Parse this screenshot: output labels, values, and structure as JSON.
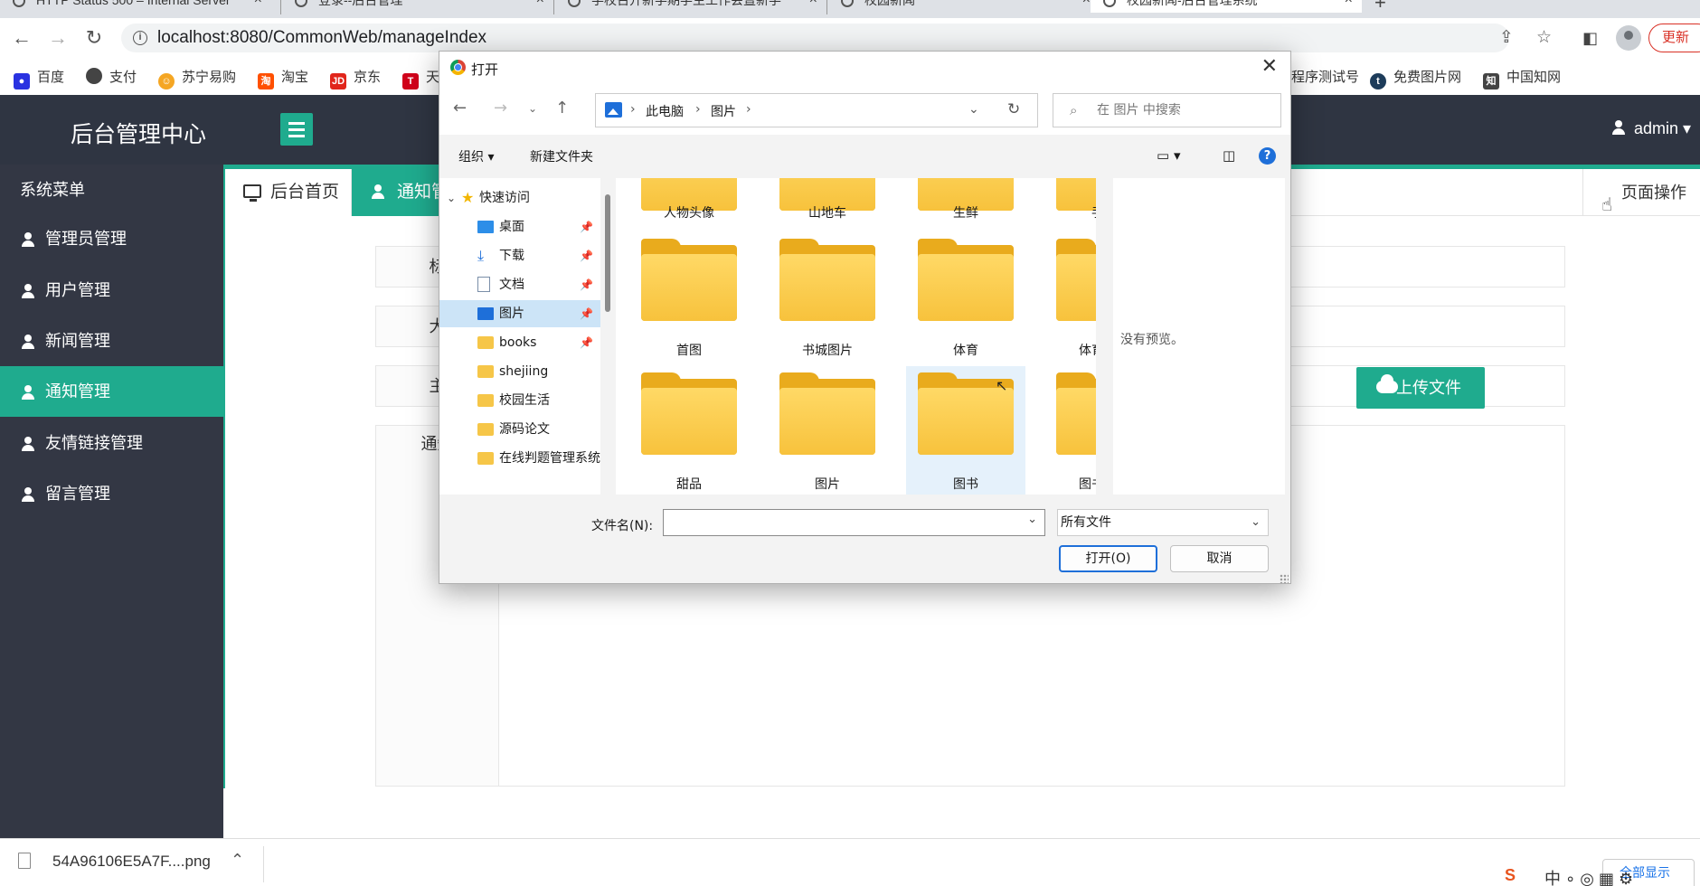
{
  "browser": {
    "tabs": [
      {
        "title": "HTTP Status 500 – Internal Server",
        "active": false
      },
      {
        "title": "登录--后台管理",
        "active": false
      },
      {
        "title": "学校召开新学期学生工作会暨新学",
        "active": false
      },
      {
        "title": "校园新闻",
        "active": false
      },
      {
        "title": "校园新闻-后台管理系统",
        "active": true
      }
    ],
    "url": "localhost:8080/CommonWeb/manageIndex",
    "update_label": "更新",
    "bookmarks_left": [
      "百度",
      "支付",
      "苏宁易购",
      "淘宝",
      "京东",
      "天"
    ],
    "bookmarks_right": [
      "程序测试号",
      "免费图片网",
      "中国知网"
    ]
  },
  "app": {
    "brand": "后台管理中心",
    "user": "admin",
    "sidebar": {
      "title": "系统菜单",
      "items": [
        {
          "label": "管理员管理",
          "active": false
        },
        {
          "label": "用户管理",
          "active": false
        },
        {
          "label": "新闻管理",
          "active": false
        },
        {
          "label": "通知管理",
          "active": true
        },
        {
          "label": "友情链接管理",
          "active": false
        },
        {
          "label": "留言管理",
          "active": false
        }
      ]
    },
    "page_tabs": {
      "home": "后台首页",
      "current": "通知管",
      "page_ops": "页面操作"
    },
    "form": {
      "labels": [
        "标",
        "大",
        "主",
        "通知"
      ],
      "upload_label": "上传文件"
    }
  },
  "dialog": {
    "title": "打开",
    "breadcrumb": [
      "此电脑",
      "图片"
    ],
    "search_placeholder": "在 图片 中搜索",
    "toolbar": {
      "organize": "组织 ▾",
      "new_folder": "新建文件夹"
    },
    "tree": [
      {
        "label": "快速访问",
        "kind": "star",
        "pinned": false,
        "selected": false
      },
      {
        "label": "桌面",
        "kind": "desktop",
        "pinned": true,
        "selected": false
      },
      {
        "label": "下载",
        "kind": "download",
        "pinned": true,
        "selected": false
      },
      {
        "label": "文档",
        "kind": "document",
        "pinned": true,
        "selected": false
      },
      {
        "label": "图片",
        "kind": "pictures",
        "pinned": true,
        "selected": true
      },
      {
        "label": "books",
        "kind": "folder",
        "pinned": true,
        "selected": false
      },
      {
        "label": "shejiing",
        "kind": "folder",
        "pinned": false,
        "selected": false
      },
      {
        "label": "校园生活",
        "kind": "folder",
        "pinned": false,
        "selected": false
      },
      {
        "label": "源码论文",
        "kind": "folder",
        "pinned": false,
        "selected": false
      },
      {
        "label": "在线判题管理系统",
        "kind": "folder",
        "pinned": false,
        "selected": false
      }
    ],
    "folders_partial": [
      "人物头像",
      "山地车",
      "生鲜",
      "手机"
    ],
    "folders": [
      "首图",
      "书城图片",
      "体育",
      "体育运动",
      "甜品",
      "图片",
      "图书",
      "图书图片"
    ],
    "hovered_folder": "图书",
    "preview_text": "没有预览。",
    "filename_label": "文件名(N):",
    "filename_value": "",
    "filetype": "所有文件",
    "open_label": "打开(O)",
    "cancel_label": "取消"
  },
  "download": {
    "file": "54A96106E5A7F....png",
    "show_all": "全部显示"
  }
}
